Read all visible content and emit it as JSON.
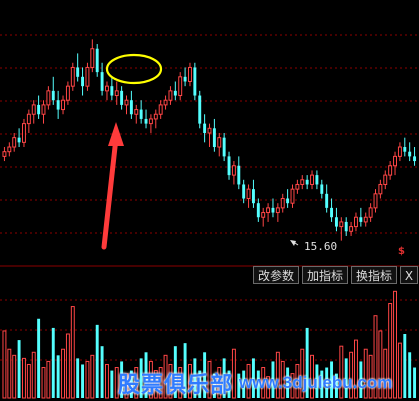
{
  "chart_data": {
    "type": "candlestick",
    "ylim": [
      14.9,
      19.6
    ],
    "price_series": [
      [
        16.9,
        17.1,
        16.8,
        17.0
      ],
      [
        17.0,
        17.2,
        16.9,
        17.1
      ],
      [
        17.1,
        17.4,
        17.0,
        17.3
      ],
      [
        17.3,
        17.5,
        17.1,
        17.2
      ],
      [
        17.2,
        17.7,
        17.1,
        17.6
      ],
      [
        17.6,
        17.9,
        17.4,
        17.8
      ],
      [
        17.8,
        18.1,
        17.6,
        18.0
      ],
      [
        18.0,
        18.2,
        17.7,
        17.8
      ],
      [
        17.8,
        18.1,
        17.6,
        18.0
      ],
      [
        18.0,
        18.4,
        17.9,
        18.3
      ],
      [
        18.3,
        18.6,
        18.0,
        18.1
      ],
      [
        18.1,
        18.3,
        17.7,
        17.9
      ],
      [
        17.9,
        18.2,
        17.8,
        18.1
      ],
      [
        18.1,
        18.5,
        18.0,
        18.4
      ],
      [
        18.4,
        18.9,
        18.3,
        18.8
      ],
      [
        18.8,
        19.1,
        18.5,
        18.6
      ],
      [
        18.6,
        18.8,
        18.2,
        18.4
      ],
      [
        18.4,
        18.9,
        18.3,
        18.8
      ],
      [
        18.8,
        19.4,
        18.7,
        19.2
      ],
      [
        19.2,
        19.3,
        18.6,
        18.7
      ],
      [
        18.7,
        18.9,
        18.2,
        18.3
      ],
      [
        18.3,
        18.5,
        18.1,
        18.4
      ],
      [
        18.4,
        18.6,
        18.1,
        18.2
      ],
      [
        18.2,
        18.5,
        18.0,
        18.3
      ],
      [
        18.3,
        18.4,
        17.9,
        18.0
      ],
      [
        18.0,
        18.2,
        17.8,
        18.1
      ],
      [
        18.1,
        18.3,
        17.7,
        17.8
      ],
      [
        17.8,
        18.0,
        17.6,
        17.9
      ],
      [
        17.9,
        18.1,
        17.6,
        17.7
      ],
      [
        17.7,
        17.9,
        17.5,
        17.6
      ],
      [
        17.6,
        17.8,
        17.4,
        17.7
      ],
      [
        17.7,
        17.9,
        17.5,
        17.8
      ],
      [
        17.8,
        18.1,
        17.7,
        18.0
      ],
      [
        18.0,
        18.2,
        17.9,
        18.1
      ],
      [
        18.1,
        18.4,
        18.0,
        18.3
      ],
      [
        18.3,
        18.5,
        18.1,
        18.2
      ],
      [
        18.2,
        18.7,
        18.1,
        18.6
      ],
      [
        18.6,
        18.8,
        18.4,
        18.5
      ],
      [
        18.5,
        18.9,
        18.4,
        18.8
      ],
      [
        18.8,
        18.9,
        18.1,
        18.2
      ],
      [
        18.2,
        18.3,
        17.5,
        17.6
      ],
      [
        17.6,
        17.8,
        17.2,
        17.4
      ],
      [
        17.4,
        17.6,
        17.1,
        17.5
      ],
      [
        17.5,
        17.7,
        17.0,
        17.1
      ],
      [
        17.1,
        17.4,
        16.9,
        17.3
      ],
      [
        17.3,
        17.4,
        16.8,
        16.9
      ],
      [
        16.9,
        17.0,
        16.4,
        16.5
      ],
      [
        16.5,
        16.8,
        16.3,
        16.7
      ],
      [
        16.7,
        16.9,
        16.2,
        16.3
      ],
      [
        16.3,
        16.4,
        15.9,
        16.0
      ],
      [
        16.0,
        16.3,
        15.8,
        16.2
      ],
      [
        16.2,
        16.4,
        15.8,
        15.9
      ],
      [
        15.9,
        16.0,
        15.5,
        15.6
      ],
      [
        15.6,
        15.8,
        15.4,
        15.7
      ],
      [
        15.7,
        15.9,
        15.5,
        15.8
      ],
      [
        15.8,
        16.0,
        15.6,
        15.7
      ],
      [
        15.7,
        15.9,
        15.5,
        15.8
      ],
      [
        15.8,
        16.1,
        15.7,
        16.0
      ],
      [
        16.0,
        16.2,
        15.8,
        15.9
      ],
      [
        15.9,
        16.3,
        15.8,
        16.2
      ],
      [
        16.2,
        16.4,
        16.1,
        16.3
      ],
      [
        16.3,
        16.5,
        16.2,
        16.4
      ],
      [
        16.4,
        16.5,
        16.2,
        16.3
      ],
      [
        16.3,
        16.6,
        16.2,
        16.5
      ],
      [
        16.5,
        16.6,
        16.2,
        16.3
      ],
      [
        16.3,
        16.4,
        16.0,
        16.1
      ],
      [
        16.1,
        16.3,
        15.7,
        15.8
      ],
      [
        15.8,
        16.0,
        15.5,
        15.6
      ],
      [
        15.6,
        15.8,
        15.3,
        15.4
      ],
      [
        15.4,
        15.6,
        15.1,
        15.5
      ],
      [
        15.5,
        15.6,
        15.2,
        15.3
      ],
      [
        15.3,
        15.5,
        15.2,
        15.4
      ],
      [
        15.4,
        15.7,
        15.3,
        15.6
      ],
      [
        15.6,
        15.8,
        15.4,
        15.5
      ],
      [
        15.5,
        15.7,
        15.4,
        15.6
      ],
      [
        15.6,
        15.9,
        15.5,
        15.8
      ],
      [
        15.8,
        16.2,
        15.7,
        16.1
      ],
      [
        16.1,
        16.4,
        16.0,
        16.3
      ],
      [
        16.3,
        16.6,
        16.2,
        16.5
      ],
      [
        16.5,
        16.8,
        16.4,
        16.7
      ],
      [
        16.7,
        17.0,
        16.5,
        16.9
      ],
      [
        16.9,
        17.2,
        16.8,
        17.1
      ],
      [
        17.1,
        17.3,
        16.9,
        17.0
      ],
      [
        17.0,
        17.2,
        16.8,
        16.9
      ],
      [
        16.9,
        17.1,
        16.7,
        16.8
      ]
    ],
    "volume_series": [
      2.2,
      1.6,
      1.4,
      1.9,
      1.3,
      1.1,
      1.5,
      2.6,
      1.0,
      1.2,
      2.3,
      1.4,
      1.6,
      2.1,
      3.0,
      1.3,
      1.1,
      1.2,
      1.4,
      2.4,
      1.7,
      1.1,
      0.9,
      1.0,
      1.2,
      0.8,
      0.9,
      1.0,
      1.3,
      1.5,
      1.2,
      0.9,
      1.0,
      1.4,
      1.1,
      1.7,
      1.0,
      1.8,
      1.1,
      1.3,
      0.9,
      1.5,
      1.2,
      0.8,
      1.0,
      1.3,
      0.9,
      1.6,
      0.8,
      0.9,
      1.1,
      1.3,
      0.9,
      1.0,
      0.7,
      1.2,
      1.5,
      1.2,
      1.0,
      0.8,
      1.1,
      1.6,
      2.3,
      1.4,
      1.1,
      0.9,
      1.0,
      1.2,
      0.8,
      1.7,
      1.3,
      1.5,
      1.9,
      1.2,
      1.6,
      1.4,
      2.7,
      2.2,
      1.6,
      3.1,
      3.5,
      1.8,
      2.1,
      1.5,
      1.0
    ],
    "min_label": "15.60",
    "min_index": 68
  },
  "toolbar": {
    "modify_params": "改参数",
    "add_indicator": "加指标",
    "switch_indicator": "换指标",
    "close": "X"
  },
  "marker": {
    "symbol": "$"
  },
  "watermark": {
    "logo": "股票俱乐部",
    "url": "www.3djulebu.com"
  },
  "colors": {
    "up": "#ff4646",
    "down": "#54ffff",
    "grid": "#8b0000",
    "arrow": "#ff3b3b",
    "circle": "#ffff00",
    "label": "#e0e0e0"
  }
}
